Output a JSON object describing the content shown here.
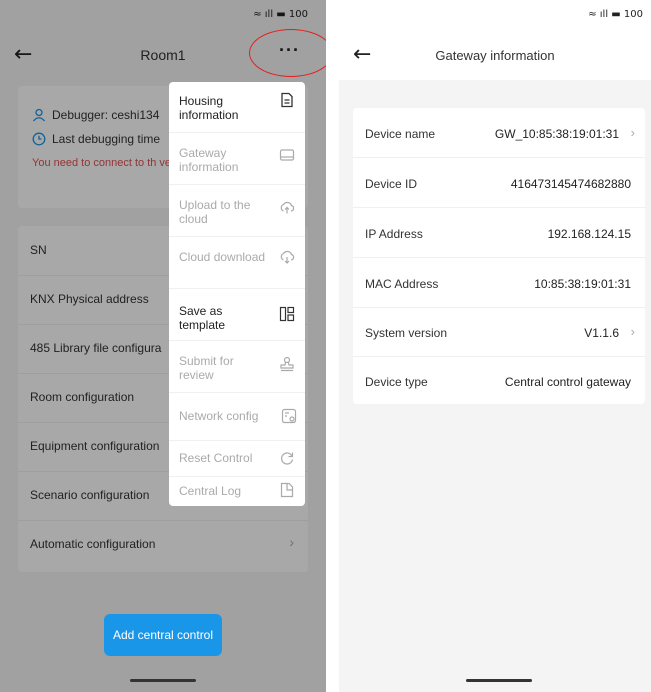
{
  "status": {
    "text": "≈ ıll ▬ 100"
  },
  "left": {
    "title": "Room1",
    "debugger": "Debugger:  ceshi134",
    "last_debugging": "Last debugging time",
    "warning": "You need to connect to th verification",
    "list": [
      {
        "label": "SN"
      },
      {
        "label": "KNX Physical address"
      },
      {
        "label": "485 Library file configura"
      },
      {
        "label": "Room configuration"
      },
      {
        "label": "Equipment configuration"
      },
      {
        "label": "Scenario configuration"
      },
      {
        "label": "Automatic configuration"
      }
    ],
    "add_button": "Add central control"
  },
  "menu": {
    "items": [
      {
        "label": "Housing information",
        "icon": "document-icon",
        "enabled": true
      },
      {
        "label": "Gateway information",
        "icon": "drive-icon",
        "enabled": false
      },
      {
        "label": "Upload to the cloud",
        "icon": "cloud-upload-icon",
        "enabled": false
      },
      {
        "label": "Cloud download",
        "icon": "cloud-download-icon",
        "enabled": false
      },
      {
        "label": "Save as template",
        "icon": "template-icon",
        "enabled": true
      },
      {
        "label": "Submit for review",
        "icon": "stamp-icon",
        "enabled": false
      },
      {
        "label": "Network config",
        "icon": "network-config-icon",
        "enabled": false
      },
      {
        "label": "Reset Control",
        "icon": "refresh-icon",
        "enabled": false
      },
      {
        "label": "Central Log",
        "icon": "log-icon",
        "enabled": false
      }
    ]
  },
  "right": {
    "title": "Gateway information",
    "rows": [
      {
        "label": "Device name",
        "value": "GW_10:85:38:19:01:31",
        "chevron": true
      },
      {
        "label": "Device ID",
        "value": "416473145474682880",
        "chevron": false
      },
      {
        "label": "IP Address",
        "value": "192.168.124.15",
        "chevron": false
      },
      {
        "label": "MAC Address",
        "value": "10:85:38:19:01:31",
        "chevron": false
      },
      {
        "label": "System version",
        "value": "V1.1.6",
        "chevron": true
      },
      {
        "label": "Device type",
        "value": "Central control gateway",
        "chevron": false
      }
    ]
  },
  "colors": {
    "accent": "#1a96e8",
    "warning": "#e05050",
    "highlight_circle": "#e02020"
  }
}
